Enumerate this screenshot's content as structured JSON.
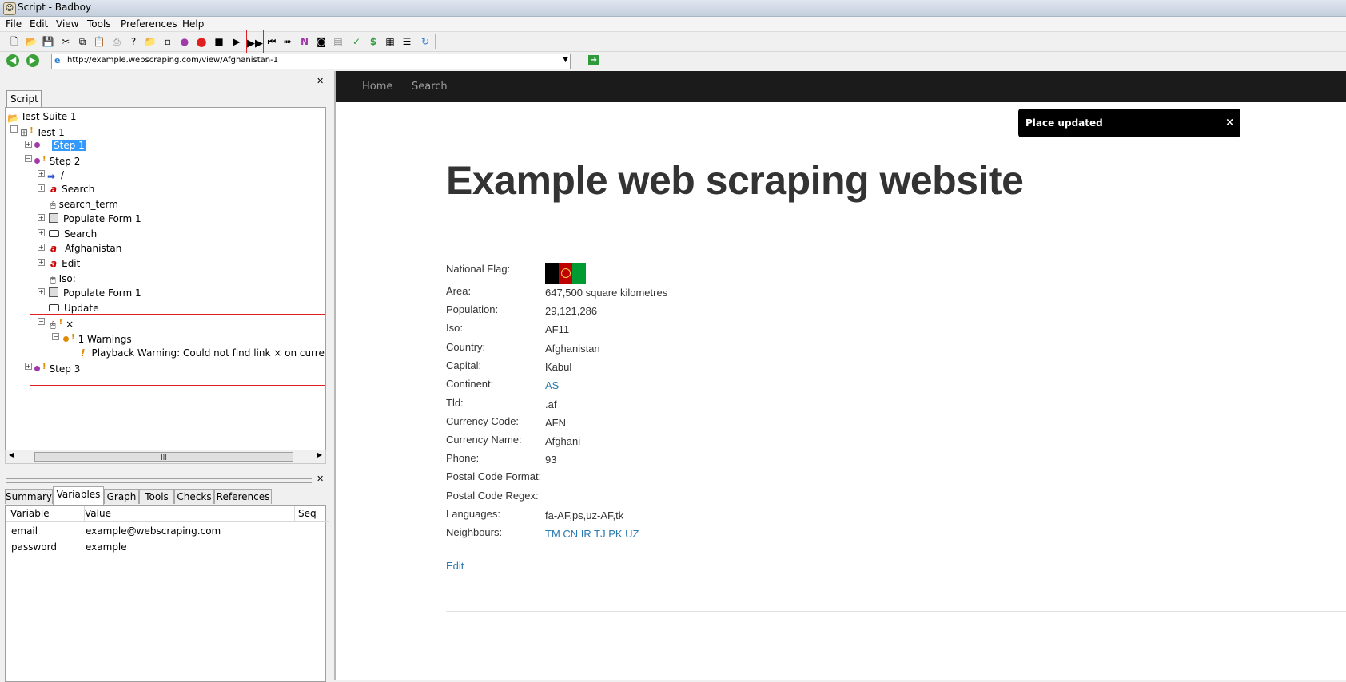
{
  "window": {
    "title": "Script - Badboy"
  },
  "menu": [
    "File",
    "Edit",
    "View",
    "Tools",
    "Preferences",
    "Help"
  ],
  "toolbar": {
    "icons": [
      "new-icon",
      "open-icon",
      "save-icon",
      "cut-icon",
      "copy-icon",
      "paste-icon",
      "print-icon",
      "help-icon",
      "add-folder-icon",
      "add-step-icon",
      "add-item-icon",
      "record-icon",
      "stop-icon",
      "play-icon",
      "play-all-icon",
      "rewind-icon",
      "jump-icon",
      "navigate-icon",
      "screenshot-icon",
      "report-icon",
      "check-icon",
      "dollar-icon",
      "table-icon",
      "list-icon",
      "refresh-icon"
    ]
  },
  "address": {
    "url": "http://example.webscraping.com/view/Afghanistan-1"
  },
  "script_tab": "Script",
  "tree": {
    "suite": "Test Suite 1",
    "test": "Test 1",
    "step1": "Step 1",
    "step2": "Step 2",
    "children": [
      "/",
      "Search",
      "search_term",
      "Populate Form 1",
      "Search",
      "Afghanistan",
      "Edit",
      "Iso:",
      "Populate Form 1",
      "Update"
    ],
    "warn_item": "×",
    "warnings": "1 Warnings",
    "warning_text": "Playback Warning: Could not find link  ×  on current page",
    "step3": "Step 3"
  },
  "bottom_tabs": [
    "Summary",
    "Variables",
    "Graph",
    "Tools",
    "Checks",
    "References"
  ],
  "variables": {
    "headers": {
      "variable": "Variable",
      "value": "Value",
      "seq": "Seq"
    },
    "rows": [
      {
        "name": "email",
        "value": "example@webscraping.com"
      },
      {
        "name": "password",
        "value": "example"
      }
    ]
  },
  "site": {
    "nav": [
      "Home",
      "Search"
    ],
    "toast": "Place updated",
    "toast_close": "×",
    "heading": "Example web scraping website",
    "fields": [
      {
        "label": "National Flag:",
        "value": ""
      },
      {
        "label": "Area:",
        "value": "647,500 square kilometres"
      },
      {
        "label": "Population:",
        "value": "29,121,286"
      },
      {
        "label": "Iso:",
        "value": "AF11"
      },
      {
        "label": "Country:",
        "value": "Afghanistan"
      },
      {
        "label": "Capital:",
        "value": "Kabul"
      },
      {
        "label": "Continent:",
        "value": "AS"
      },
      {
        "label": "Tld:",
        "value": ".af"
      },
      {
        "label": "Currency Code:",
        "value": "AFN"
      },
      {
        "label": "Currency Name:",
        "value": "Afghani"
      },
      {
        "label": "Phone:",
        "value": "93"
      },
      {
        "label": "Postal Code Format:",
        "value": ""
      },
      {
        "label": "Postal Code Regex:",
        "value": ""
      },
      {
        "label": "Languages:",
        "value": "fa-AF,ps,uz-AF,tk"
      },
      {
        "label": "Neighbours:",
        "value": "TM CN IR TJ PK UZ"
      }
    ],
    "edit_link": "Edit",
    "flag_colors": [
      "#000000",
      "#be0000",
      "#009a33"
    ]
  }
}
